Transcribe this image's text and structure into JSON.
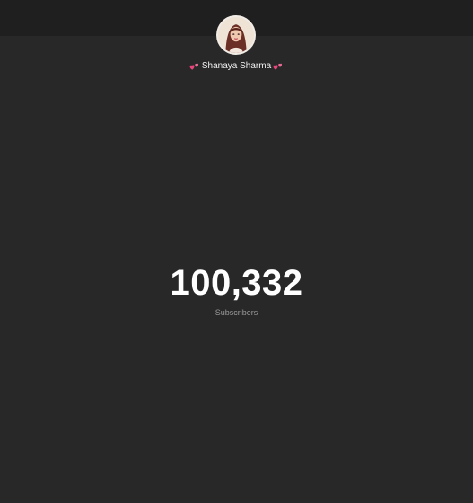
{
  "channel": {
    "name": "Shanaya Sharma",
    "avatar_icon": "profile-photo",
    "decoration_icon": "two-hearts-icon",
    "accent_color": "#e8457c"
  },
  "stats": {
    "subscriber_count": "100,332",
    "subscriber_label": "Subscribers"
  },
  "colors": {
    "background": "#282828",
    "top_bar": "#1f1f1f",
    "count_text": "#ffffff",
    "label_text": "#9a9a9a"
  }
}
